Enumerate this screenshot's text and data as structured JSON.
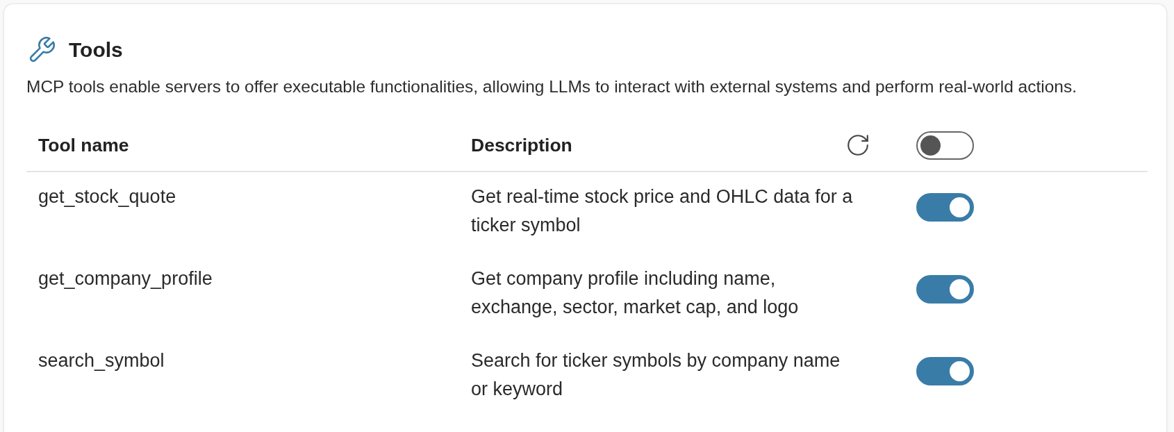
{
  "section": {
    "title": "Tools",
    "description": "MCP tools enable servers to offer executable functionalities, allowing LLMs to interact with external systems and perform real-world actions."
  },
  "table": {
    "columns": [
      "Tool name",
      "Description"
    ],
    "toggle_all": {
      "on": false
    },
    "rows": [
      {
        "name": "get_stock_quote",
        "description": "Get real-time stock price and OHLC data for a ticker symbol",
        "enabled": true
      },
      {
        "name": "get_company_profile",
        "description": "Get company profile including name, exchange, sector, market cap, and logo",
        "enabled": true
      },
      {
        "name": "search_symbol",
        "description": "Search for ticker symbols by company name or keyword",
        "enabled": true
      }
    ]
  }
}
